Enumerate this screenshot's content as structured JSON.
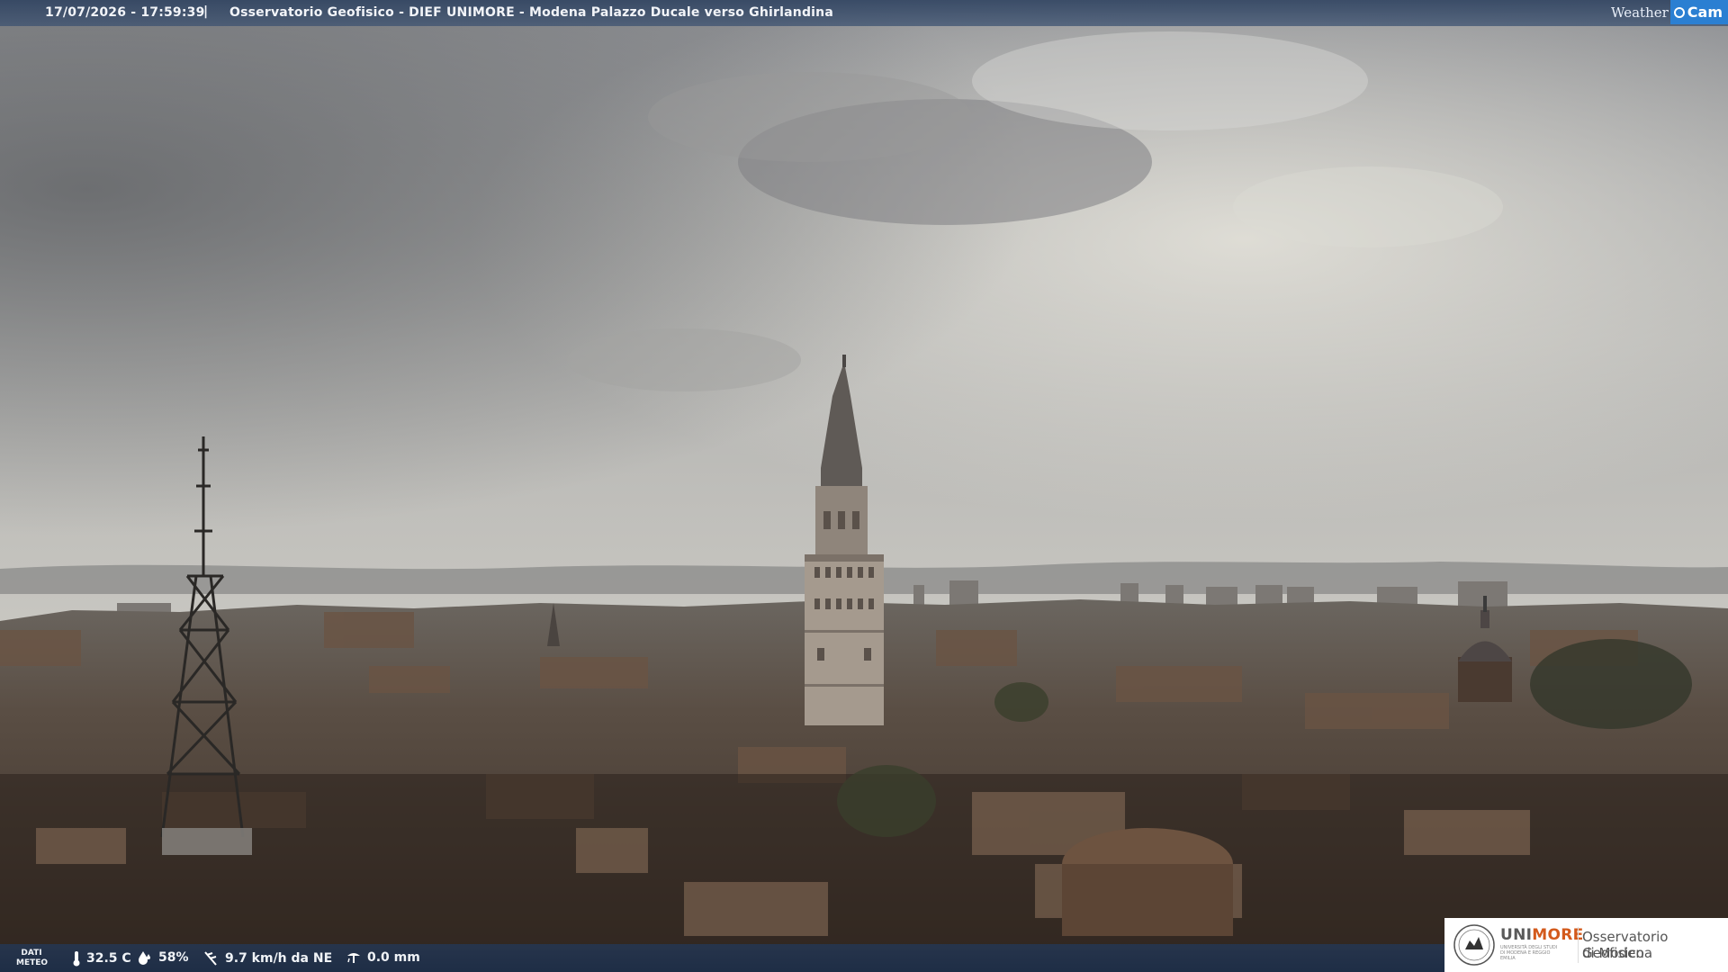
{
  "header": {
    "timestamp": "17/07/2026 - 17:59:39",
    "separator": "|",
    "caption": "Osservatorio Geofisico - DIEF UNIMORE - Modena Palazzo Ducale verso Ghirlandina",
    "brand_weather": "Weather",
    "brand_cam": "Cam"
  },
  "weather": {
    "label_line1": "DATI",
    "label_line2": "METEO",
    "temperature": "32.5 C",
    "humidity": "58%",
    "wind": "9.7 km/h da NE",
    "rain": "0.0 mm"
  },
  "logo": {
    "uni_part1": "UNI",
    "uni_part2": "MORE",
    "uni_sub": "UNIVERSITÀ DEGLI STUDI DI MODENA E REGGIO EMILIA",
    "org_line1": "Osservatorio Geofisico",
    "org_line2": "di Modena"
  },
  "colors": {
    "bar": "#2e4260",
    "brand_accent": "#2b7fd2",
    "logo_accent": "#d35a1c"
  },
  "icons": [
    "thermometer-icon",
    "humidity-drop-icon",
    "wind-icon",
    "rain-gauge-icon",
    "university-seal-icon"
  ]
}
